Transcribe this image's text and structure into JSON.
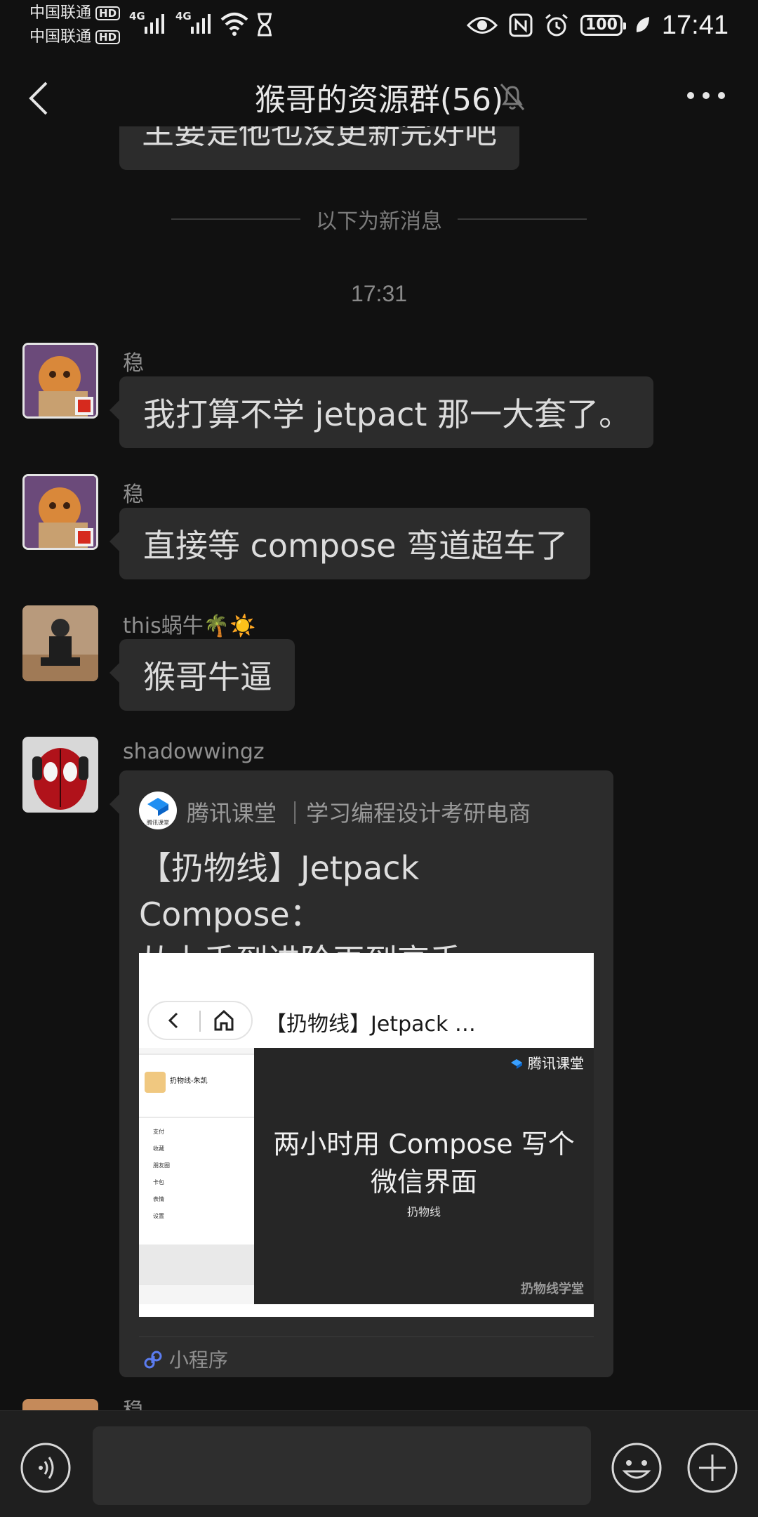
{
  "status_bar": {
    "carrier1": "中国联通",
    "carrier2": "中国联通",
    "hd": "HD",
    "network1": "4G",
    "network2": "4G",
    "battery": "100",
    "time": "17:41"
  },
  "header": {
    "title": "猴哥的资源群(56)"
  },
  "chat": {
    "partial_text": "主要是他也没更新完好吧",
    "new_messages_divider": "以下为新消息",
    "timestamp": "17:31",
    "messages": [
      {
        "sender": "稳",
        "text": "我打算不学 jetpact 那一大套了。"
      },
      {
        "sender": "稳",
        "text": "直接等 compose 弯道超车了"
      },
      {
        "sender": "this蜗牛🌴☀️",
        "text": "猴哥牛逼"
      },
      {
        "sender": "shadowwingz"
      }
    ],
    "card": {
      "logo_text": "腾讯课堂",
      "source": "腾讯课堂 ｜学习编程设计考研电商",
      "title": "【扔物线】Jetpack Compose：\n从上手到进阶再到高手",
      "thumb_url_text": "【扔物线】Jetpack …",
      "thumb_brand": "腾讯课堂",
      "thumb_profile_name": "扔物线-朱凯",
      "thumb_menu": [
        "支付",
        "收藏",
        "朋友圈",
        "卡包",
        "表情",
        "设置"
      ],
      "video_title": "两小时用 Compose 写个\n微信界面",
      "video_sub": "扔物线",
      "video_watermark": "扔物线学堂",
      "footer": "小程序"
    },
    "next_sender": "稳"
  },
  "colors": {
    "background": "#111111",
    "bubble": "#2c2c2c",
    "accent_blue": "#3a7bfd"
  }
}
